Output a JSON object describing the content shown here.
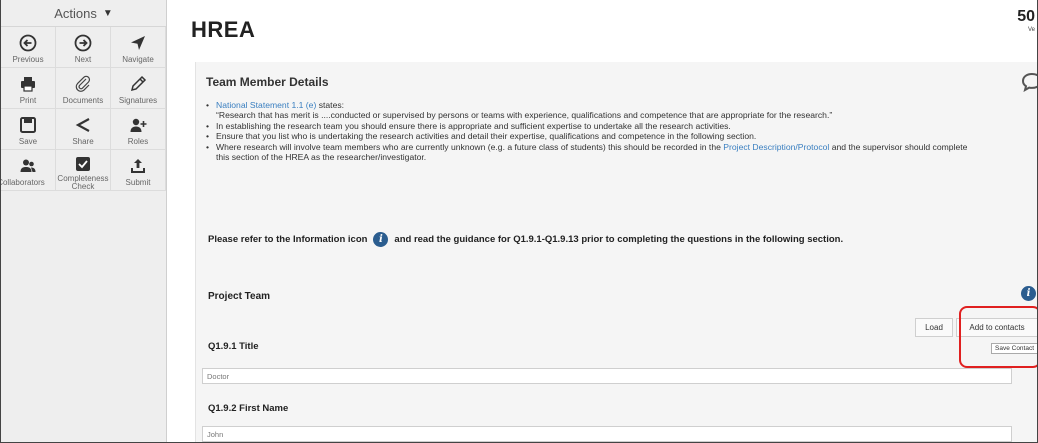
{
  "sidebar": {
    "header": "Actions",
    "tools": [
      {
        "label": "Previous",
        "icon": "arrow-left-circle-icon"
      },
      {
        "label": "Next",
        "icon": "arrow-right-circle-icon"
      },
      {
        "label": "Navigate",
        "icon": "navigate-arrow-icon"
      },
      {
        "label": "Print",
        "icon": "printer-icon"
      },
      {
        "label": "Documents",
        "icon": "paperclip-icon"
      },
      {
        "label": "Signatures",
        "icon": "pen-icon"
      },
      {
        "label": "Save",
        "icon": "floppy-disk-icon"
      },
      {
        "label": "Share",
        "icon": "share-icon"
      },
      {
        "label": "Roles",
        "icon": "user-plus-icon"
      },
      {
        "label": "Collaborators",
        "icon": "users-icon"
      },
      {
        "label": "Completeness Check",
        "icon": "checkbox-icon"
      },
      {
        "label": "Submit",
        "icon": "upload-icon"
      }
    ]
  },
  "main": {
    "title": "HREA",
    "top_number": "50",
    "top_version": "Ve"
  },
  "panel": {
    "title": "Team Member Details",
    "bullets": {
      "b1_link": "National Statement 1.1 (e)",
      "b1_text": " states:",
      "b1_quote": "“Research that has merit is ....conducted or supervised by persons or teams with experience, qualifications and competence that are appropriate for the research.”",
      "b2": "In establishing the research team you should ensure there is appropriate and sufficient expertise to undertake all the research activities.",
      "b3": "Ensure that you list who is undertaking the research activities and detail their expertise, qualifications and competence in the following section.",
      "b4_text": "Where research will involve team members who are currently unknown (e.g. a future class of students) this should be recorded in the ",
      "b4_link": "Project Description/Protocol",
      "b4_tail": " and the supervisor should complete this section of the HREA as the researcher/investigator."
    },
    "refer_before": "Please refer to the Information icon",
    "refer_after": "and read the guidance for Q1.9.1-Q1.9.13 prior to completing the questions in the following section.",
    "info_glyph": "i",
    "section_title": "Project Team",
    "load_button": "Load",
    "add_contacts_button": "Add to contacts",
    "tooltip": "Save Contact",
    "q1_label": "Q1.9.1  Title",
    "q1_value": "Doctor",
    "q2_label": "Q1.9.2  First Name",
    "q2_value": "John"
  },
  "colors": {
    "highlight": "#e02020",
    "info": "#2b5d8f",
    "link": "#3a7fc0"
  }
}
